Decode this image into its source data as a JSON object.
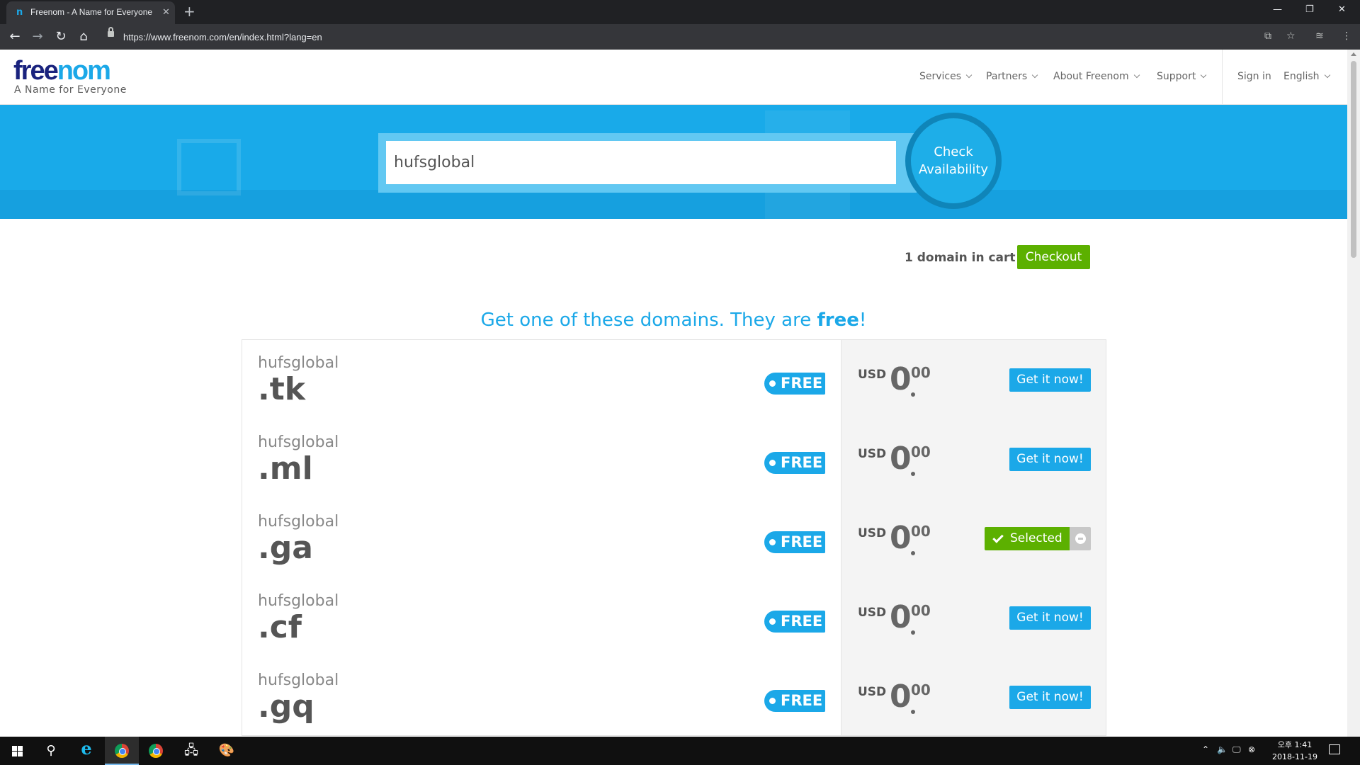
{
  "browser": {
    "tab_title": "Freenom - A Name for Everyone",
    "tab_favicon": "n",
    "url": "https://www.freenom.com/en/index.html?lang=en"
  },
  "header": {
    "logo_free": "free",
    "logo_nom": "nom",
    "tagline": "A Name for Everyone",
    "nav": {
      "services": "Services",
      "partners": "Partners",
      "about": "About Freenom",
      "support": "Support",
      "signin": "Sign in",
      "language": "English"
    }
  },
  "search": {
    "value": "hufsglobal",
    "button_line1": "Check",
    "button_line2": "Availability"
  },
  "cart": {
    "count_text": "1 domain in cart",
    "checkout_label": "Checkout"
  },
  "free_section": {
    "heading_prefix": "Get one of these domains. They are ",
    "heading_bold": "free",
    "heading_suffix": "!"
  },
  "domains": [
    {
      "name": "hufsglobal",
      "tld": ".tk",
      "badge": "FREE",
      "currency": "USD",
      "price_int": "0",
      "price_dec": "00",
      "action": "Get it now!",
      "selected": false
    },
    {
      "name": "hufsglobal",
      "tld": ".ml",
      "badge": "FREE",
      "currency": "USD",
      "price_int": "0",
      "price_dec": "00",
      "action": "Get it now!",
      "selected": false
    },
    {
      "name": "hufsglobal",
      "tld": ".ga",
      "badge": "FREE",
      "currency": "USD",
      "price_int": "0",
      "price_dec": "00",
      "action": "Selected",
      "selected": true
    },
    {
      "name": "hufsglobal",
      "tld": ".cf",
      "badge": "FREE",
      "currency": "USD",
      "price_int": "0",
      "price_dec": "00",
      "action": "Get it now!",
      "selected": false
    },
    {
      "name": "hufsglobal",
      "tld": ".gq",
      "badge": "FREE",
      "currency": "USD",
      "price_int": "0",
      "price_dec": "00",
      "action": "Get it now!",
      "selected": false
    }
  ],
  "taskbar": {
    "clock_line1": "오후 1:41",
    "clock_line2": "2018-11-19"
  },
  "colors": {
    "brand_blue": "#1ba8e8",
    "brand_navy": "#1a237e",
    "success_green": "#5cb000"
  }
}
